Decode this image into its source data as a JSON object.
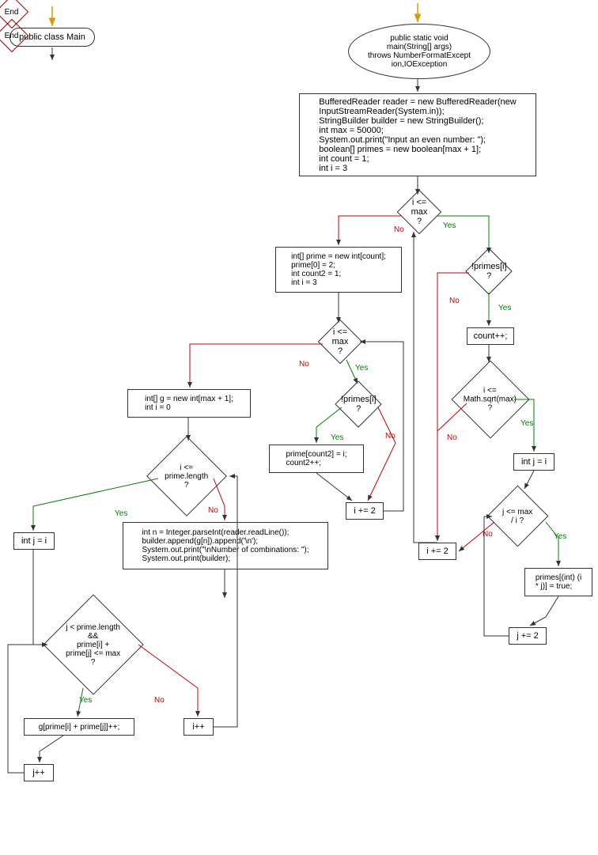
{
  "chart_data": {
    "type": "flowchart",
    "title": "",
    "nodes": [
      {
        "id": "n1",
        "type": "terminal",
        "text": "public class Main"
      },
      {
        "id": "n2",
        "type": "end",
        "text": "End"
      },
      {
        "id": "n3",
        "type": "terminal",
        "text": "public static void\nmain(String[] args)\nthrows NumberFormatExcept\nion,IOException"
      },
      {
        "id": "n4",
        "type": "process",
        "text": "BufferedReader reader = new BufferedReader(new\nInputStreamReader(System.in));\nStringBuilder builder = new StringBuilder();\nint max = 50000;\nSystem.out.print(\"Input an even number: \");\nboolean[] primes = new boolean[max + 1];\nint count = 1;\nint i = 3"
      },
      {
        "id": "n5",
        "type": "decision",
        "text": "i <= max ?"
      },
      {
        "id": "n6",
        "type": "decision",
        "text": "!primes[i] ?"
      },
      {
        "id": "n7",
        "type": "process",
        "text": "count++;"
      },
      {
        "id": "n8",
        "type": "decision",
        "text": "i <= Math.sqrt(max) ?"
      },
      {
        "id": "n9",
        "type": "process",
        "text": "int j = i"
      },
      {
        "id": "n10",
        "type": "decision",
        "text": "j <= max / i ?"
      },
      {
        "id": "n11",
        "type": "process",
        "text": "primes[(int) (i\n* j)] = true;"
      },
      {
        "id": "n12",
        "type": "process",
        "text": "j += 2"
      },
      {
        "id": "n13",
        "type": "process",
        "text": "i += 2"
      },
      {
        "id": "n14",
        "type": "process",
        "text": "int[] prime = new int[count];\nprime[0] = 2;\nint count2 = 1;\nint i = 3"
      },
      {
        "id": "n15",
        "type": "decision",
        "text": "i <= max ?"
      },
      {
        "id": "n16",
        "type": "decision",
        "text": "!primes[i] ?"
      },
      {
        "id": "n17",
        "type": "process",
        "text": "prime[count2] = i;\ncount2++;"
      },
      {
        "id": "n18",
        "type": "process",
        "text": "i += 2"
      },
      {
        "id": "n19",
        "type": "process",
        "text": "int[] g = new int[max + 1];\nint i = 0"
      },
      {
        "id": "n20",
        "type": "decision",
        "text": "i <= prime.length ?"
      },
      {
        "id": "n21",
        "type": "process",
        "text": "int j = i"
      },
      {
        "id": "n22",
        "type": "decision",
        "text": "j < prime.length &&\nprime[i] +\nprime[j] <= max ?"
      },
      {
        "id": "n23",
        "type": "process",
        "text": "g[prime[i] + prime[j]]++;"
      },
      {
        "id": "n24",
        "type": "process",
        "text": "j++"
      },
      {
        "id": "n25",
        "type": "process",
        "text": "i++"
      },
      {
        "id": "n26",
        "type": "process",
        "text": "int n = Integer.parseInt(reader.readLine());\nbuilder.append(g[n]).append('\\n');\nSystem.out.print(\"\\nNumber of combinations: \");\nSystem.out.print(builder);"
      },
      {
        "id": "n27",
        "type": "end",
        "text": "End"
      }
    ],
    "edges": [
      {
        "from": "entry1",
        "to": "n1"
      },
      {
        "from": "n1",
        "to": "n2"
      },
      {
        "from": "entry2",
        "to": "n3"
      },
      {
        "from": "n3",
        "to": "n4"
      },
      {
        "from": "n4",
        "to": "n5"
      },
      {
        "from": "n5",
        "to": "n6",
        "label": "Yes"
      },
      {
        "from": "n5",
        "to": "n14",
        "label": "No"
      },
      {
        "from": "n6",
        "to": "n7",
        "label": "Yes"
      },
      {
        "from": "n6",
        "to": "n13",
        "label": "No"
      },
      {
        "from": "n7",
        "to": "n8"
      },
      {
        "from": "n8",
        "to": "n9",
        "label": "Yes"
      },
      {
        "from": "n8",
        "to": "n13",
        "label": "No"
      },
      {
        "from": "n9",
        "to": "n10"
      },
      {
        "from": "n10",
        "to": "n11",
        "label": "Yes"
      },
      {
        "from": "n10",
        "to": "n13",
        "label": "No"
      },
      {
        "from": "n11",
        "to": "n12"
      },
      {
        "from": "n12",
        "to": "n10"
      },
      {
        "from": "n13",
        "to": "n5"
      },
      {
        "from": "n14",
        "to": "n15"
      },
      {
        "from": "n15",
        "to": "n16",
        "label": "Yes"
      },
      {
        "from": "n15",
        "to": "n19",
        "label": "No"
      },
      {
        "from": "n16",
        "to": "n17",
        "label": "Yes"
      },
      {
        "from": "n16",
        "to": "n18",
        "label": "No"
      },
      {
        "from": "n17",
        "to": "n18"
      },
      {
        "from": "n18",
        "to": "n15"
      },
      {
        "from": "n19",
        "to": "n20"
      },
      {
        "from": "n20",
        "to": "n21",
        "label": "Yes"
      },
      {
        "from": "n20",
        "to": "n26",
        "label": "No"
      },
      {
        "from": "n21",
        "to": "n22"
      },
      {
        "from": "n22",
        "to": "n23",
        "label": "Yes"
      },
      {
        "from": "n22",
        "to": "n25",
        "label": "No"
      },
      {
        "from": "n23",
        "to": "n24"
      },
      {
        "from": "n24",
        "to": "n22"
      },
      {
        "from": "n25",
        "to": "n20"
      },
      {
        "from": "n26",
        "to": "n27"
      }
    ]
  },
  "labels": {
    "yes": "Yes",
    "no": "No"
  }
}
